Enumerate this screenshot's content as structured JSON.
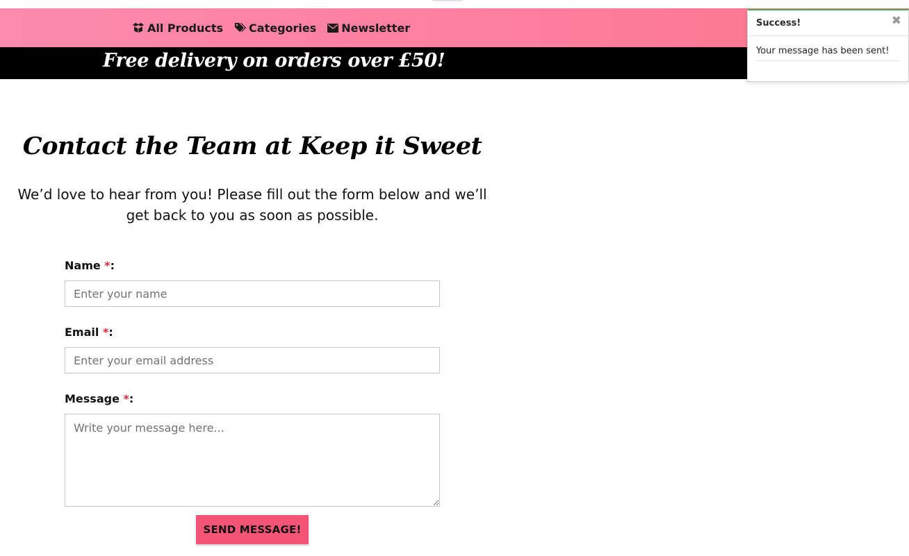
{
  "nav": {
    "items": [
      {
        "label": "All Products",
        "icon": "box-open-icon"
      },
      {
        "label": "Categories",
        "icon": "tags-icon"
      },
      {
        "label": "Newsletter",
        "icon": "envelope-icon"
      }
    ]
  },
  "promo": {
    "text": "Free delivery on orders over £50!"
  },
  "contact": {
    "title": "Contact the Team at Keep it Sweet",
    "intro": "We’d love to hear from you! Please fill out the form below and we’ll get back to you as soon as possible."
  },
  "form": {
    "required_mark": "*",
    "name": {
      "label": "Name",
      "placeholder": "Enter your name",
      "value": ""
    },
    "email": {
      "label": "Email",
      "placeholder": "Enter your email address",
      "value": ""
    },
    "message": {
      "label": "Message",
      "placeholder": "Write your message here...",
      "value": ""
    },
    "submit_label": "SEND MESSAGE!"
  },
  "toast": {
    "title": "Success!",
    "message": "Your message has been sent!",
    "close_icon": "close-icon"
  },
  "colors": {
    "nav_gradient_start": "#fc8aae",
    "nav_gradient_end": "#fd7690",
    "promo_bg": "#000000",
    "button_bg": "#f45577",
    "required": "#e0283c",
    "toast_accent": "#3cb54a"
  }
}
